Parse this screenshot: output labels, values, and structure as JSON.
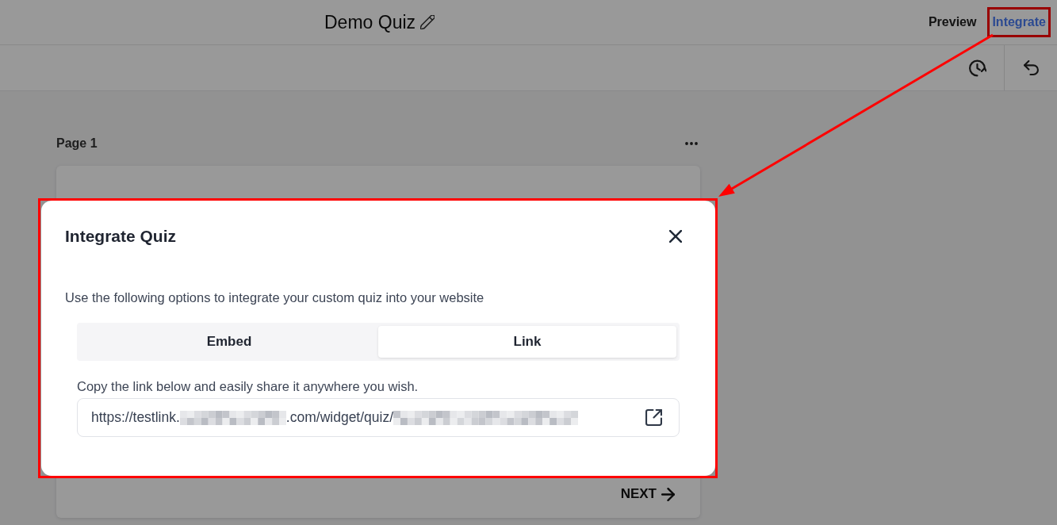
{
  "header": {
    "title": "Demo Quiz",
    "actions": [
      {
        "label": "Preview",
        "selected": false,
        "highlighted": false
      },
      {
        "label": "Integrate",
        "selected": true,
        "highlighted": true
      }
    ]
  },
  "page": {
    "title": "Page 1",
    "next_button": "NEXT"
  },
  "modal": {
    "title": "Integrate Quiz",
    "highlighted": true,
    "description": "Use the following options to integrate your custom quiz into your website",
    "tabs": [
      {
        "label": "Embed",
        "selected": false
      },
      {
        "label": "Link",
        "selected": true
      }
    ],
    "link_label": "Copy the link below and easily share it anywhere you wish.",
    "link_field": {
      "segments": [
        {
          "kind": "text",
          "text": "https://testlink."
        },
        {
          "kind": "redacted"
        },
        {
          "kind": "text",
          "text": ".com/widget/quiz/"
        },
        {
          "kind": "redacted"
        }
      ]
    }
  },
  "callout_arrow": true
}
